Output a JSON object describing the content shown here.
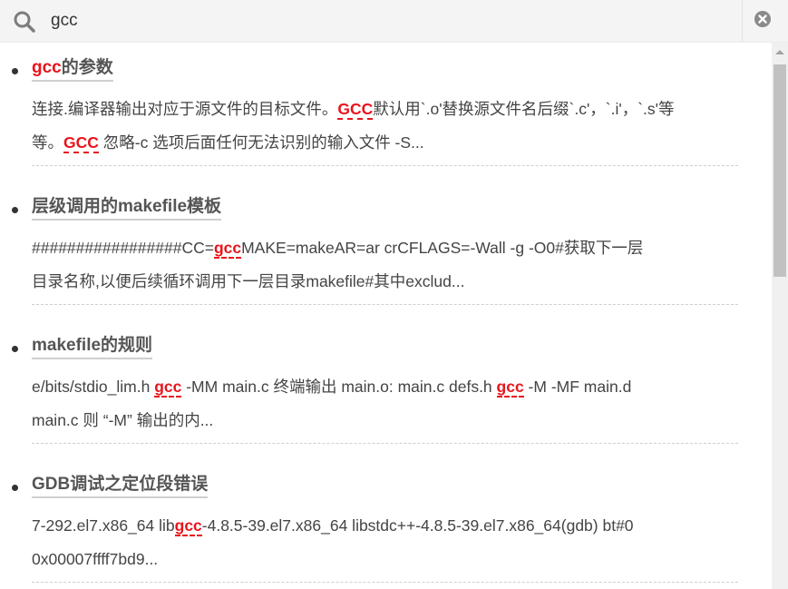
{
  "search": {
    "query": "gcc"
  },
  "results": [
    {
      "title_parts": [
        {
          "t": "gcc",
          "hl": true
        },
        {
          "t": "的参数",
          "hl": false
        }
      ],
      "lines": [
        [
          {
            "t": "连接.编译器输出对应于源文件的目标文件。",
            "hl": false
          },
          {
            "t": "GCC",
            "hl": true
          },
          {
            "t": "默认用`.o'替换源文件名后缀`.c'，`.i'，`.s'等",
            "hl": false
          }
        ],
        [
          {
            "t": "等。",
            "hl": false
          },
          {
            "t": "GCC",
            "hl": true
          },
          {
            "t": " 忽略-c 选项后面任何无法识别的输入文件 -S...",
            "hl": false
          }
        ]
      ]
    },
    {
      "title_parts": [
        {
          "t": "层级调用的makefile模板",
          "hl": false
        }
      ],
      "lines": [
        [
          {
            "t": "#################CC=",
            "hl": false
          },
          {
            "t": "gcc",
            "hl": true
          },
          {
            "t": "MAKE=makeAR=ar crCFLAGS=-Wall -g -O0#获取下一层",
            "hl": false
          }
        ],
        [
          {
            "t": "目录名称,以便后续循环调用下一层目录makefile#其中exclud...",
            "hl": false
          }
        ]
      ]
    },
    {
      "title_parts": [
        {
          "t": "makefile的规则",
          "hl": false
        }
      ],
      "lines": [
        [
          {
            "t": "e/bits/stdio_lim.h ",
            "hl": false
          },
          {
            "t": "gcc",
            "hl": true
          },
          {
            "t": " -MM main.c 终端输出 main.o: main.c defs.h ",
            "hl": false
          },
          {
            "t": "gcc",
            "hl": true
          },
          {
            "t": " -M -MF main.d",
            "hl": false
          }
        ],
        [
          {
            "t": "main.c 则 “-M” 输出的内...",
            "hl": false
          }
        ]
      ]
    },
    {
      "title_parts": [
        {
          "t": "GDB调试之定位段错误",
          "hl": false
        }
      ],
      "lines": [
        [
          {
            "t": "7-292.el7.x86_64 lib",
            "hl": false
          },
          {
            "t": "gcc",
            "hl": true
          },
          {
            "t": "-4.8.5-39.el7.x86_64 libstdc++-4.8.5-39.el7.x86_64(gdb) bt#0",
            "hl": false
          }
        ],
        [
          {
            "t": "0x00007ffff7bd9...",
            "hl": false
          }
        ]
      ]
    }
  ],
  "colors": {
    "highlight": "#e8141c",
    "title": "#555555",
    "text": "#444444"
  },
  "icons": {
    "search": "search-icon",
    "clear": "clear-icon"
  }
}
